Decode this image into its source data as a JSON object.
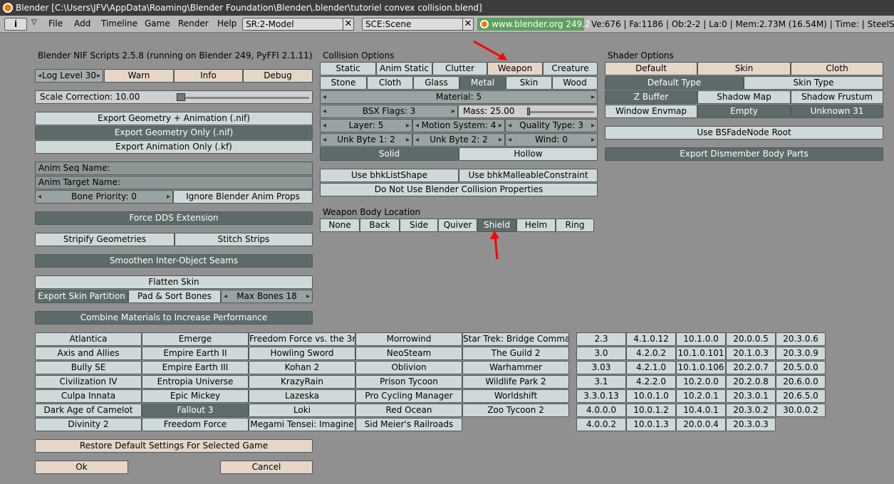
{
  "window": {
    "title": "Blender [C:\\Users\\JFV\\AppData\\Roaming\\Blender Foundation\\Blender\\.blender\\tutoriel convex collision.blend]"
  },
  "menubar": {
    "items": [
      "File",
      "Add",
      "Timeline",
      "Game",
      "Render",
      "Help"
    ],
    "screen": "SR:2-Model",
    "scene": "SCE:Scene",
    "url": "www.blender.org 249.2",
    "stats": "Ve:676 | Fa:1186 | Ob:2-2 | La:0  | Mem:2.73M (16.54M)  | Time: | SteelShie"
  },
  "left": {
    "header": "Blender NIF Scripts 2.5.8 (running on Blender 249, PyFFI 2.1.11)",
    "log_level": "Log Level 30",
    "warn": "Warn",
    "info": "Info",
    "debug": "Debug",
    "scale": "Scale Correction:  10.00",
    "exp_geo_anim": "Export Geometry + Animation (.nif)",
    "exp_geo_only": "Export Geometry Only (.nif)",
    "exp_anim_only": "Export Animation Only (.kf)",
    "anim_seq": "Anim Seq Name:",
    "anim_target": "Anim Target Name:",
    "bone_priority": "Bone Priority: 0",
    "ignore_anim": "Ignore Blender Anim Props",
    "force_dds": "Force DDS Extension",
    "stripify": "Stripify Geometries",
    "stitch": "Stitch Strips",
    "smoothen": "Smoothen Inter-Object Seams",
    "flatten": "Flatten Skin",
    "skin_partition": "Export Skin Partition",
    "pad_sort": "Pad & Sort Bones",
    "max_bones": "Max Bones 18",
    "combine": "Combine Materials to Increase Performance",
    "restore": "Restore Default Settings For Selected Game",
    "ok": "Ok",
    "cancel": "Cancel"
  },
  "collision": {
    "header": "Collision Options",
    "row1": [
      "Static",
      "Anim Static",
      "Clutter",
      "Weapon",
      "Creature"
    ],
    "row2": [
      "Stone",
      "Cloth",
      "Glass",
      "Metal",
      "Skin",
      "Wood"
    ],
    "material": "Material:  5",
    "bsx": "BSX Flags:  3",
    "mass": "Mass:  25.00",
    "layer": "Layer:  5",
    "motion": "Motion System:  4",
    "quality": "Quality Type:  3",
    "unk1": "Unk Byte 1:  2",
    "unk2": "Unk Byte 2:  2",
    "wind": "Wind:  0",
    "solid": "Solid",
    "hollow": "Hollow",
    "bhklist": "Use bhkListShape",
    "bhkmall": "Use bhkMalleableConstraint",
    "donotuse": "Do Not Use Blender Collision Properties"
  },
  "weapon_body": {
    "header": "Weapon Body Location",
    "items": [
      "None",
      "Back",
      "Side",
      "Quiver",
      "Shield",
      "Helm",
      "Ring"
    ]
  },
  "shader": {
    "header": "Shader Options",
    "row1": [
      "Default",
      "Skin",
      "Cloth"
    ],
    "default_type": "Default Type",
    "skin_type": "Skin Type",
    "zbuffer": "Z Buffer",
    "shadowmap": "Shadow Map",
    "shadowfrustum": "Shadow Frustum",
    "envmap": "Window Envmap",
    "empty": "Empty",
    "unknown31": "Unknown 31",
    "bsfade": "Use BSFadeNode Root",
    "dismember": "Export Dismember Body Parts"
  },
  "games": {
    "col1": [
      "Atlantica",
      "Axis and Allies",
      "Bully SE",
      "Civilization IV",
      "Culpa Innata",
      "Dark Age of Camelot",
      "Divinity 2"
    ],
    "col2": [
      "Emerge",
      "Empire Earth II",
      "Empire Earth III",
      "Entropia Universe",
      "Epic Mickey",
      "Fallout 3",
      "Freedom Force"
    ],
    "col3": [
      "Freedom Force vs. the 3r",
      "Howling Sword",
      "Kohan 2",
      "KrazyRain",
      "Lazeska",
      "Loki",
      "Megami Tensei: Imagine"
    ],
    "col4": [
      "Morrowind",
      "NeoSteam",
      "Oblivion",
      "Prison Tycoon",
      "Pro Cycling Manager",
      "Red Ocean",
      "Sid Meier's Railroads"
    ],
    "col5": [
      "Star Trek: Bridge Comman",
      "The Guild 2",
      "Warhammer",
      "Wildlife Park 2",
      "Worldshift",
      "Zoo Tycoon 2"
    ]
  },
  "versions": {
    "col1": [
      "2.3",
      "3.0",
      "3.03",
      "3.1",
      "3.3.0.13",
      "4.0.0.0",
      "4.0.0.2"
    ],
    "col2": [
      "4.1.0.12",
      "4.2.0.2",
      "4.2.1.0",
      "4.2.2.0",
      "10.0.1.0",
      "10.0.1.2",
      "10.0.1.3"
    ],
    "col3": [
      "10.1.0.0",
      "10.1.0.101",
      "10.1.0.106",
      "10.2.0.0",
      "10.2.0.1",
      "10.4.0.1",
      "20.0.0.4"
    ],
    "col4": [
      "20.0.0.5",
      "20.1.0.3",
      "20.2.0.7",
      "20.2.0.8",
      "20.3.0.1",
      "20.3.0.2",
      "20.3.0.3"
    ],
    "col5": [
      "20.3.0.6",
      "20.3.0.9",
      "20.5.0.0",
      "20.6.0.0",
      "20.6.5.0",
      "30.0.0.2"
    ]
  }
}
